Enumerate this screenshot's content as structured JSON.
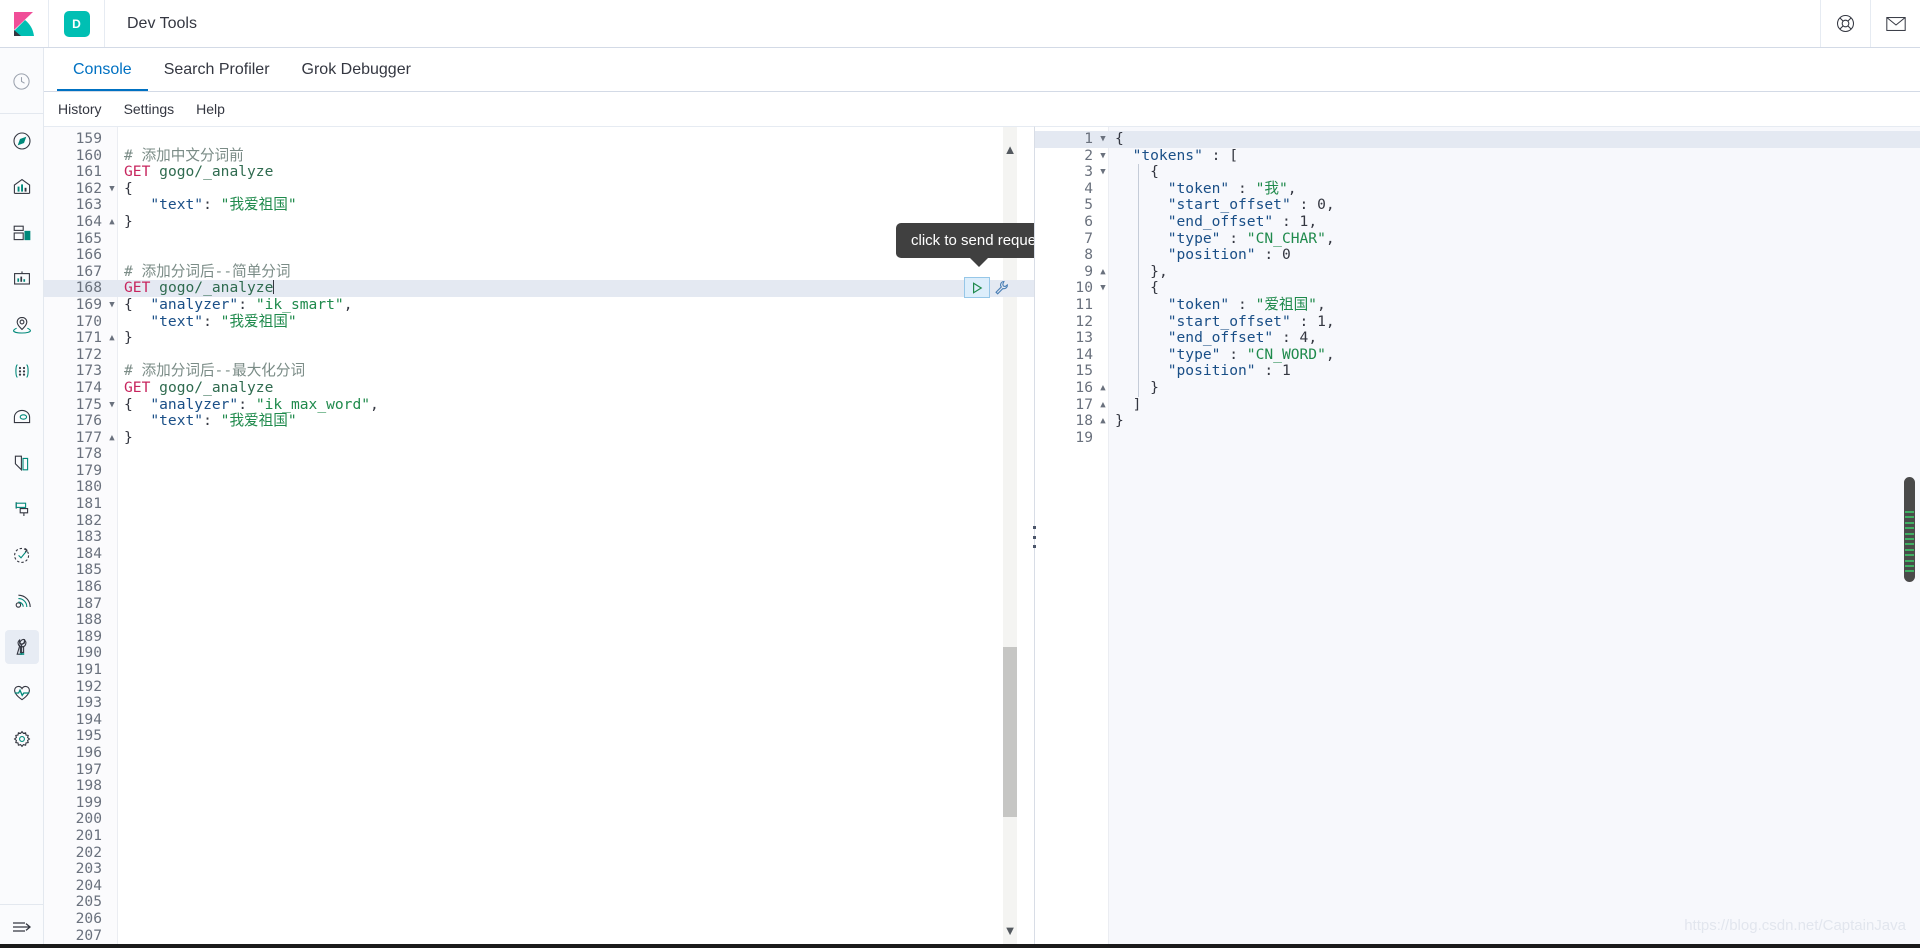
{
  "header": {
    "logo_icon": "kibana-logo-icon",
    "space_initial": "D",
    "title": "Dev Tools",
    "help_icon": "lifebuoy-help-icon",
    "mail_icon": "envelope-icon"
  },
  "sidebar": {
    "recent_icon": "clock-recently-viewed-icon",
    "items": [
      {
        "icon": "compass-discover-icon",
        "label": "Discover"
      },
      {
        "icon": "bar-chart-visualize-icon",
        "label": "Visualize"
      },
      {
        "icon": "dashboard-icon",
        "label": "Dashboard"
      },
      {
        "icon": "canvas-icon",
        "label": "Canvas"
      },
      {
        "icon": "maps-icon",
        "label": "Maps"
      },
      {
        "icon": "machine-learning-icon",
        "label": "Machine Learning"
      },
      {
        "icon": "infrastructure-icon",
        "label": "Infrastructure"
      },
      {
        "icon": "logs-icon",
        "label": "Logs"
      },
      {
        "icon": "apm-icon",
        "label": "APM"
      },
      {
        "icon": "uptime-icon",
        "label": "Uptime"
      },
      {
        "icon": "siem-icon",
        "label": "SIEM"
      },
      {
        "icon": "wrench-dev-tools-icon",
        "label": "Dev Tools",
        "active": true
      },
      {
        "icon": "heartbeat-monitoring-icon",
        "label": "Monitoring"
      },
      {
        "icon": "gear-management-icon",
        "label": "Management"
      }
    ],
    "collapse_icon": "collapse-arrow-icon"
  },
  "tabs": [
    {
      "label": "Console",
      "active": true
    },
    {
      "label": "Search Profiler",
      "active": false
    },
    {
      "label": "Grok Debugger",
      "active": false
    }
  ],
  "menubar": [
    {
      "label": "History"
    },
    {
      "label": "Settings"
    },
    {
      "label": "Help"
    }
  ],
  "tooltip": {
    "text": "click to send request"
  },
  "actions": {
    "play_icon": "play-send-request-icon",
    "wrench_icon": "wrench-options-icon"
  },
  "editor": {
    "first_visible_line": 159,
    "last_visible_line": 207,
    "highlight_line": 168,
    "cursor_line": 168,
    "lines": [
      {
        "n": 159,
        "fold": "",
        "tokens": []
      },
      {
        "n": 160,
        "fold": "",
        "tokens": [
          {
            "t": "comment",
            "v": "# 添加中文分词前"
          }
        ]
      },
      {
        "n": 161,
        "fold": "",
        "tokens": [
          {
            "t": "method",
            "v": "GET"
          },
          {
            "t": "plain",
            "v": " "
          },
          {
            "t": "url",
            "v": "gogo/_analyze"
          }
        ]
      },
      {
        "n": 162,
        "fold": "open",
        "tokens": [
          {
            "t": "punct",
            "v": "{"
          }
        ]
      },
      {
        "n": 163,
        "fold": "",
        "tokens": [
          {
            "t": "plain",
            "v": "   "
          },
          {
            "t": "key",
            "v": "\"text\""
          },
          {
            "t": "punct",
            "v": ": "
          },
          {
            "t": "string",
            "v": "\"我爱祖国\""
          }
        ]
      },
      {
        "n": 164,
        "fold": "close",
        "tokens": [
          {
            "t": "punct",
            "v": "}"
          }
        ]
      },
      {
        "n": 165,
        "fold": "",
        "tokens": []
      },
      {
        "n": 166,
        "fold": "",
        "tokens": []
      },
      {
        "n": 167,
        "fold": "",
        "tokens": [
          {
            "t": "comment",
            "v": "# 添加分词后--简单分词"
          }
        ]
      },
      {
        "n": 168,
        "fold": "",
        "tokens": [
          {
            "t": "method",
            "v": "GET"
          },
          {
            "t": "plain",
            "v": " "
          },
          {
            "t": "url",
            "v": "gogo/_analyze"
          },
          {
            "t": "caret",
            "v": ""
          }
        ]
      },
      {
        "n": 169,
        "fold": "open",
        "tokens": [
          {
            "t": "punct",
            "v": "{  "
          },
          {
            "t": "key",
            "v": "\"analyzer\""
          },
          {
            "t": "punct",
            "v": ": "
          },
          {
            "t": "string",
            "v": "\"ik_smart\""
          },
          {
            "t": "punct",
            "v": ","
          }
        ]
      },
      {
        "n": 170,
        "fold": "",
        "tokens": [
          {
            "t": "plain",
            "v": "   "
          },
          {
            "t": "key",
            "v": "\"text\""
          },
          {
            "t": "punct",
            "v": ": "
          },
          {
            "t": "string",
            "v": "\"我爱祖国\""
          }
        ]
      },
      {
        "n": 171,
        "fold": "close",
        "tokens": [
          {
            "t": "punct",
            "v": "}"
          }
        ]
      },
      {
        "n": 172,
        "fold": "",
        "tokens": []
      },
      {
        "n": 173,
        "fold": "",
        "tokens": [
          {
            "t": "comment",
            "v": "# 添加分词后--最大化分词"
          }
        ]
      },
      {
        "n": 174,
        "fold": "",
        "tokens": [
          {
            "t": "method",
            "v": "GET"
          },
          {
            "t": "plain",
            "v": " "
          },
          {
            "t": "url",
            "v": "gogo/_analyze"
          }
        ]
      },
      {
        "n": 175,
        "fold": "open",
        "tokens": [
          {
            "t": "punct",
            "v": "{  "
          },
          {
            "t": "key",
            "v": "\"analyzer\""
          },
          {
            "t": "punct",
            "v": ": "
          },
          {
            "t": "string",
            "v": "\"ik_max_word\""
          },
          {
            "t": "punct",
            "v": ","
          }
        ]
      },
      {
        "n": 176,
        "fold": "",
        "tokens": [
          {
            "t": "plain",
            "v": "   "
          },
          {
            "t": "key",
            "v": "\"text\""
          },
          {
            "t": "punct",
            "v": ": "
          },
          {
            "t": "string",
            "v": "\"我爱祖国\""
          }
        ]
      },
      {
        "n": 177,
        "fold": "close",
        "tokens": [
          {
            "t": "punct",
            "v": "}"
          }
        ]
      },
      {
        "n": 178,
        "fold": "",
        "tokens": []
      },
      {
        "n": 179,
        "fold": "",
        "tokens": []
      },
      {
        "n": 180,
        "fold": "",
        "tokens": []
      },
      {
        "n": 181,
        "fold": "",
        "tokens": []
      },
      {
        "n": 182,
        "fold": "",
        "tokens": []
      },
      {
        "n": 183,
        "fold": "",
        "tokens": []
      },
      {
        "n": 184,
        "fold": "",
        "tokens": []
      },
      {
        "n": 185,
        "fold": "",
        "tokens": []
      },
      {
        "n": 186,
        "fold": "",
        "tokens": []
      },
      {
        "n": 187,
        "fold": "",
        "tokens": []
      },
      {
        "n": 188,
        "fold": "",
        "tokens": []
      },
      {
        "n": 189,
        "fold": "",
        "tokens": []
      },
      {
        "n": 190,
        "fold": "",
        "tokens": []
      },
      {
        "n": 191,
        "fold": "",
        "tokens": []
      },
      {
        "n": 192,
        "fold": "",
        "tokens": []
      },
      {
        "n": 193,
        "fold": "",
        "tokens": []
      },
      {
        "n": 194,
        "fold": "",
        "tokens": []
      },
      {
        "n": 195,
        "fold": "",
        "tokens": []
      },
      {
        "n": 196,
        "fold": "",
        "tokens": []
      },
      {
        "n": 197,
        "fold": "",
        "tokens": []
      },
      {
        "n": 198,
        "fold": "",
        "tokens": []
      },
      {
        "n": 199,
        "fold": "",
        "tokens": []
      },
      {
        "n": 200,
        "fold": "",
        "tokens": []
      },
      {
        "n": 201,
        "fold": "",
        "tokens": []
      },
      {
        "n": 202,
        "fold": "",
        "tokens": []
      },
      {
        "n": 203,
        "fold": "",
        "tokens": []
      },
      {
        "n": 204,
        "fold": "",
        "tokens": []
      },
      {
        "n": 205,
        "fold": "",
        "tokens": []
      },
      {
        "n": 206,
        "fold": "",
        "tokens": []
      },
      {
        "n": 207,
        "fold": "",
        "tokens": []
      }
    ]
  },
  "response": {
    "first_visible_line": 1,
    "last_visible_line": 19,
    "highlight_line": 1,
    "lines": [
      {
        "n": 1,
        "fold": "open",
        "tokens": [
          {
            "t": "punct",
            "v": "{"
          }
        ]
      },
      {
        "n": 2,
        "fold": "open",
        "tokens": [
          {
            "t": "plain",
            "v": "  "
          },
          {
            "t": "key",
            "v": "\"tokens\""
          },
          {
            "t": "punct",
            "v": " : ["
          }
        ]
      },
      {
        "n": 3,
        "fold": "open",
        "tokens": [
          {
            "t": "plain",
            "v": "    "
          },
          {
            "t": "punct",
            "v": "{"
          }
        ]
      },
      {
        "n": 4,
        "fold": "",
        "tokens": [
          {
            "t": "plain",
            "v": "      "
          },
          {
            "t": "key",
            "v": "\"token\""
          },
          {
            "t": "punct",
            "v": " : "
          },
          {
            "t": "string",
            "v": "\"我\""
          },
          {
            "t": "punct",
            "v": ","
          }
        ]
      },
      {
        "n": 5,
        "fold": "",
        "tokens": [
          {
            "t": "plain",
            "v": "      "
          },
          {
            "t": "key",
            "v": "\"start_offset\""
          },
          {
            "t": "punct",
            "v": " : "
          },
          {
            "t": "num",
            "v": "0"
          },
          {
            "t": "punct",
            "v": ","
          }
        ]
      },
      {
        "n": 6,
        "fold": "",
        "tokens": [
          {
            "t": "plain",
            "v": "      "
          },
          {
            "t": "key",
            "v": "\"end_offset\""
          },
          {
            "t": "punct",
            "v": " : "
          },
          {
            "t": "num",
            "v": "1"
          },
          {
            "t": "punct",
            "v": ","
          }
        ]
      },
      {
        "n": 7,
        "fold": "",
        "tokens": [
          {
            "t": "plain",
            "v": "      "
          },
          {
            "t": "key",
            "v": "\"type\""
          },
          {
            "t": "punct",
            "v": " : "
          },
          {
            "t": "string",
            "v": "\"CN_CHAR\""
          },
          {
            "t": "punct",
            "v": ","
          }
        ]
      },
      {
        "n": 8,
        "fold": "",
        "tokens": [
          {
            "t": "plain",
            "v": "      "
          },
          {
            "t": "key",
            "v": "\"position\""
          },
          {
            "t": "punct",
            "v": " : "
          },
          {
            "t": "num",
            "v": "0"
          }
        ]
      },
      {
        "n": 9,
        "fold": "close",
        "tokens": [
          {
            "t": "plain",
            "v": "    "
          },
          {
            "t": "punct",
            "v": "},"
          }
        ]
      },
      {
        "n": 10,
        "fold": "open",
        "tokens": [
          {
            "t": "plain",
            "v": "    "
          },
          {
            "t": "punct",
            "v": "{"
          }
        ]
      },
      {
        "n": 11,
        "fold": "",
        "tokens": [
          {
            "t": "plain",
            "v": "      "
          },
          {
            "t": "key",
            "v": "\"token\""
          },
          {
            "t": "punct",
            "v": " : "
          },
          {
            "t": "string",
            "v": "\"爱祖国\""
          },
          {
            "t": "punct",
            "v": ","
          }
        ]
      },
      {
        "n": 12,
        "fold": "",
        "tokens": [
          {
            "t": "plain",
            "v": "      "
          },
          {
            "t": "key",
            "v": "\"start_offset\""
          },
          {
            "t": "punct",
            "v": " : "
          },
          {
            "t": "num",
            "v": "1"
          },
          {
            "t": "punct",
            "v": ","
          }
        ]
      },
      {
        "n": 13,
        "fold": "",
        "tokens": [
          {
            "t": "plain",
            "v": "      "
          },
          {
            "t": "key",
            "v": "\"end_offset\""
          },
          {
            "t": "punct",
            "v": " : "
          },
          {
            "t": "num",
            "v": "4"
          },
          {
            "t": "punct",
            "v": ","
          }
        ]
      },
      {
        "n": 14,
        "fold": "",
        "tokens": [
          {
            "t": "plain",
            "v": "      "
          },
          {
            "t": "key",
            "v": "\"type\""
          },
          {
            "t": "punct",
            "v": " : "
          },
          {
            "t": "string",
            "v": "\"CN_WORD\""
          },
          {
            "t": "punct",
            "v": ","
          }
        ]
      },
      {
        "n": 15,
        "fold": "",
        "tokens": [
          {
            "t": "plain",
            "v": "      "
          },
          {
            "t": "key",
            "v": "\"position\""
          },
          {
            "t": "punct",
            "v": " : "
          },
          {
            "t": "num",
            "v": "1"
          }
        ]
      },
      {
        "n": 16,
        "fold": "close",
        "tokens": [
          {
            "t": "plain",
            "v": "    "
          },
          {
            "t": "punct",
            "v": "}"
          }
        ]
      },
      {
        "n": 17,
        "fold": "close",
        "tokens": [
          {
            "t": "plain",
            "v": "  "
          },
          {
            "t": "punct",
            "v": "]"
          }
        ]
      },
      {
        "n": 18,
        "fold": "close",
        "tokens": [
          {
            "t": "punct",
            "v": "}"
          }
        ]
      },
      {
        "n": 19,
        "fold": "",
        "tokens": []
      }
    ]
  },
  "watermark": "https://blog.csdn.net/CaptainJava",
  "colors": {
    "accent": "#0071c2",
    "space_badge": "#00bfb3",
    "highlight_row": "#e4e9f2",
    "tooltip_bg": "#404040",
    "minimap_mark": "#3fae62"
  }
}
